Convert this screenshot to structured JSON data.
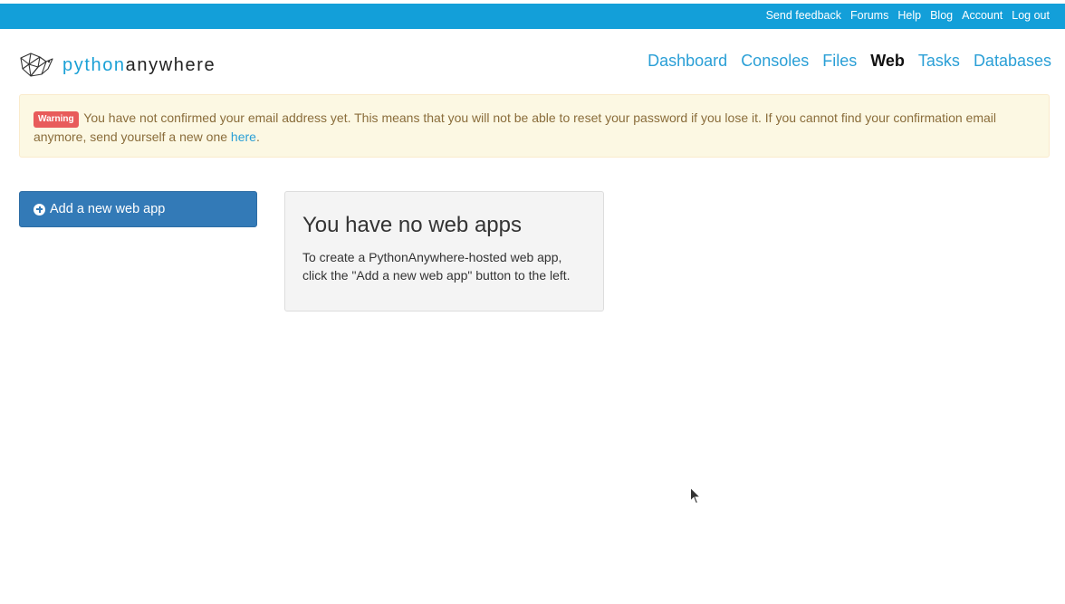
{
  "topbar": {
    "links": [
      "Send feedback",
      "Forums",
      "Help",
      "Blog",
      "Account",
      "Log out"
    ]
  },
  "brand": {
    "part1": "python",
    "part2": "anywhere",
    "icon": "pythonanywhere-logo-icon"
  },
  "nav": {
    "items": [
      "Dashboard",
      "Consoles",
      "Files",
      "Web",
      "Tasks",
      "Databases"
    ],
    "active": "Web"
  },
  "alert": {
    "badge": "Warning",
    "text": "You have not confirmed your email address yet. This means that you will not be able to reset your password if you lose it. If you cannot find your confirmation email anymore, send yourself a new one ",
    "link_text": "here",
    "suffix": "."
  },
  "add_button": {
    "label": "Add a new web app",
    "icon": "plus-circle-icon"
  },
  "empty_state": {
    "title": "You have no web apps",
    "line1": "To create a PythonAnywhere-hosted web app,",
    "line2": "click the \"Add a new web app\" button to the left."
  },
  "colors": {
    "topbar": "#139fd9",
    "link": "#2a9fd6",
    "primary_button": "#337ab7",
    "warning_bg": "#fcf8e3",
    "warning_text": "#8a6d3b",
    "badge": "#e85b5b"
  }
}
